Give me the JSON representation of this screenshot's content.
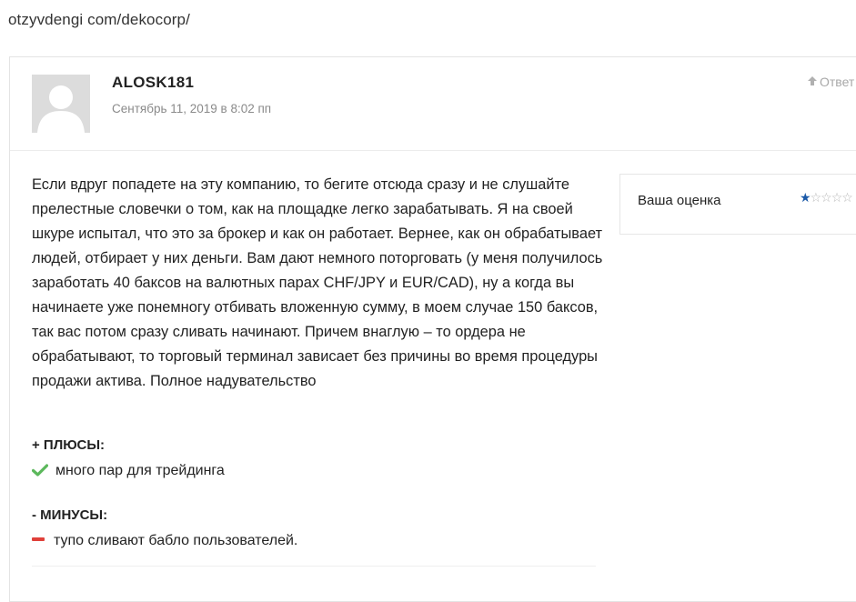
{
  "url_text": "otzyvdengi com/dekocorp/",
  "comment": {
    "author": "ALOSK181",
    "date": "Сентябрь 11, 2019 в 8:02 пп",
    "reply_label": "Ответ",
    "text": "Если вдруг попадете на эту компанию, то бегите отсюда сразу и не слушайте прелестные словечки о том, как на площадке легко зарабатывать. Я на своей шкуре испытал, что это за брокер и как он работает. Вернее, как он обрабатывает людей, отбирает у них деньги. Вам дают немного поторговать (у меня получилось заработать 40 баксов на валютных парах CHF/JPY и EUR/CAD), ну а когда вы начинаете уже понемногу отбивать вложенную сумму, в моем случае 150 баксов, так вас потом сразу сливать начинают. Причем внаглую – то ордера не обрабатывают, то торговый терминал зависает без причины во время процедуры продажи актива. Полное надувательство",
    "rating": {
      "label": "Ваша оценка",
      "value": 1,
      "max": 5,
      "filled_color": "#1c5aa8",
      "empty_color": "#b7b7b7"
    },
    "pros": {
      "title": "+ ПЛЮСЫ:",
      "items": [
        "много пар для трейдинга"
      ],
      "icon": "check-icon",
      "icon_color": "#5cb85c"
    },
    "cons": {
      "title": "- МИНУСЫ:",
      "items": [
        "тупо сливают бабло пользователей."
      ],
      "icon": "minus-icon",
      "icon_color": "#e0403a"
    }
  }
}
